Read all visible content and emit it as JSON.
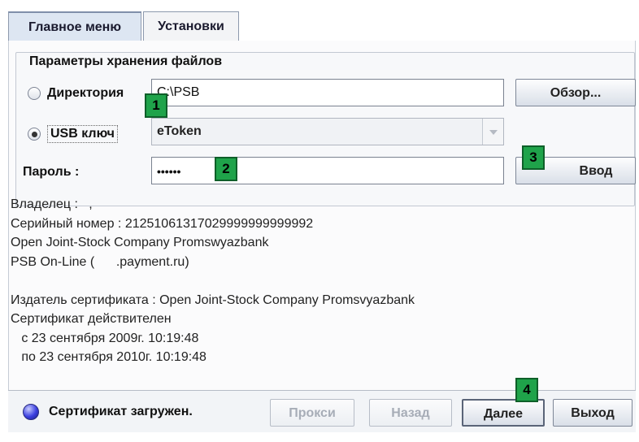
{
  "tabs": [
    {
      "label": "Главное меню",
      "active": true
    },
    {
      "label": "Установки",
      "active": false
    }
  ],
  "group": {
    "title": "Параметры хранения файлов"
  },
  "storage": {
    "directory_label": "Директория",
    "directory_selected": false,
    "directory_value": "C:\\PSB",
    "browse_label": "Обзор...",
    "usb_label": "USB ключ",
    "usb_selected": true,
    "usb_value": "eToken"
  },
  "password": {
    "label": "Пароль :",
    "value": "••••••",
    "enter_label": "Ввод"
  },
  "badges": [
    "1",
    "2",
    "3",
    "4"
  ],
  "certificate": {
    "lines": [
      "Владелец :   ,",
      "Серийный номер : 21251061317029999999999992",
      "Open Joint-Stock Company Promswyazbank",
      "PSB On-Line (      .payment.ru)",
      "",
      "Издатель сертификата : Open Joint-Stock Company Promsvyazbank",
      "Сертификат действителен",
      "   с 23 сентября 2009г. 10:19:48",
      "   по 23 сентября 2010г. 10:19:48"
    ]
  },
  "status": {
    "text": "Сертификат загружен.",
    "indicator_color": "#3b3fe0"
  },
  "footer": {
    "proxy_label": "Прокси",
    "back_label": "Назад",
    "next_label": "Далее",
    "exit_label": "Выход"
  },
  "colors": {
    "badge": "#1fa34a",
    "tab_active": "#dde6f2"
  }
}
